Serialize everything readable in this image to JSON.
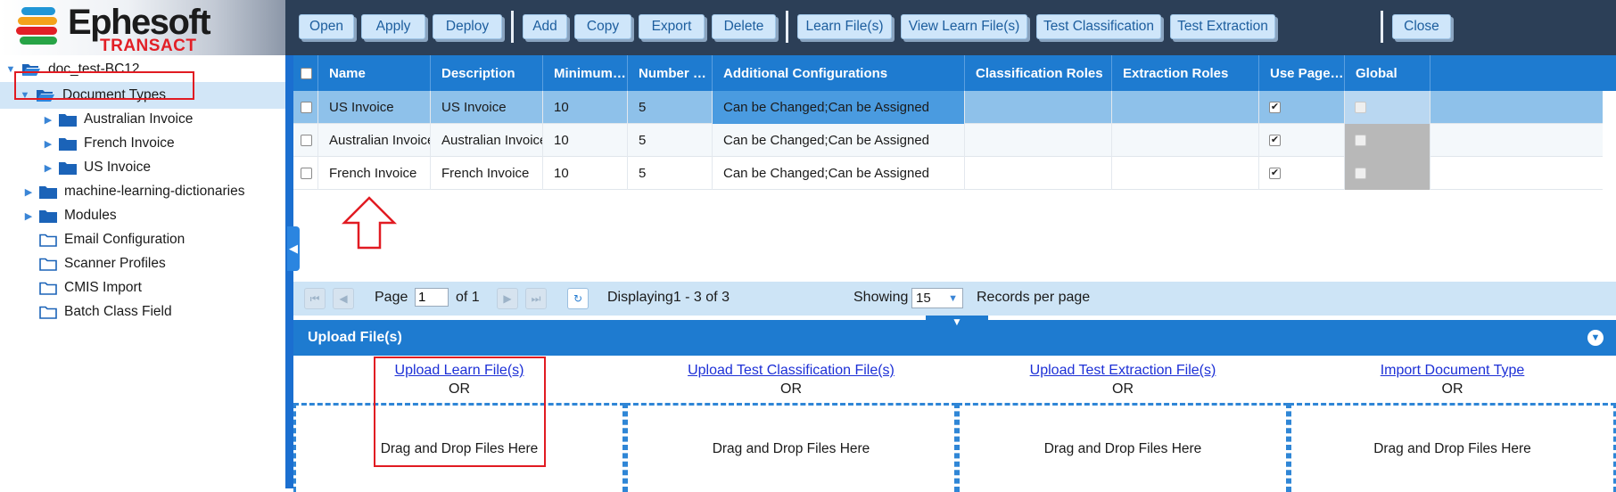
{
  "brand": {
    "name": "Ephesoft",
    "product": "TRANSACT",
    "colors": {
      "accent": "#1e7bd0",
      "toolbar": "#2c3f57",
      "highlight": "#e11b22"
    }
  },
  "tree": {
    "root": "doc_test-BC12",
    "items": [
      {
        "label": "Document Types"
      },
      {
        "label": "Australian Invoice"
      },
      {
        "label": "French Invoice"
      },
      {
        "label": "US Invoice"
      },
      {
        "label": "machine-learning-dictionaries"
      },
      {
        "label": "Modules"
      },
      {
        "label": "Email Configuration"
      },
      {
        "label": "Scanner Profiles"
      },
      {
        "label": "CMIS Import"
      },
      {
        "label": "Batch Class Field"
      }
    ]
  },
  "toolbar": {
    "open": "Open",
    "apply": "Apply",
    "deploy": "Deploy",
    "add": "Add",
    "copy": "Copy",
    "export": "Export",
    "delete": "Delete",
    "learn_files": "Learn File(s)",
    "view_learn_files": "View Learn File(s)",
    "test_classification": "Test Classification",
    "test_extraction": "Test Extraction",
    "close": "Close"
  },
  "grid": {
    "columns": [
      "Name",
      "Description",
      "Minimum…",
      "Number …",
      "Additional Configurations",
      "Classification Roles",
      "Extraction Roles",
      "Use Page…",
      "Global"
    ],
    "rows": [
      {
        "name": "US Invoice",
        "description": "US Invoice",
        "minimum": "10",
        "number": "5",
        "additional": "Can be Changed;Can be Assigned",
        "classification_roles": "",
        "extraction_roles": "",
        "use_page": true,
        "global": false,
        "selected": true
      },
      {
        "name": "Australian Invoice",
        "description": "Australian Invoice",
        "minimum": "10",
        "number": "5",
        "additional": "Can be Changed;Can be Assigned",
        "classification_roles": "",
        "extraction_roles": "",
        "use_page": true,
        "global": false,
        "selected": false
      },
      {
        "name": "French Invoice",
        "description": "French Invoice",
        "minimum": "10",
        "number": "5",
        "additional": "Can be Changed;Can be Assigned",
        "classification_roles": "",
        "extraction_roles": "",
        "use_page": true,
        "global": false,
        "selected": false
      }
    ]
  },
  "pager": {
    "page_label": "Page",
    "page_value": "1",
    "of_label": "of 1",
    "displaying": "Displaying1 - 3 of 3",
    "showing_label": "Showing",
    "per_page_value": "15",
    "records_label": "Records per page"
  },
  "upload": {
    "title": "Upload File(s)",
    "or_label": "OR",
    "drop_label": "Drag and Drop Files Here",
    "links": [
      "Upload Learn File(s)",
      "Upload Test Classification File(s)",
      "Upload Test Extraction File(s)",
      "Import Document Type"
    ]
  }
}
